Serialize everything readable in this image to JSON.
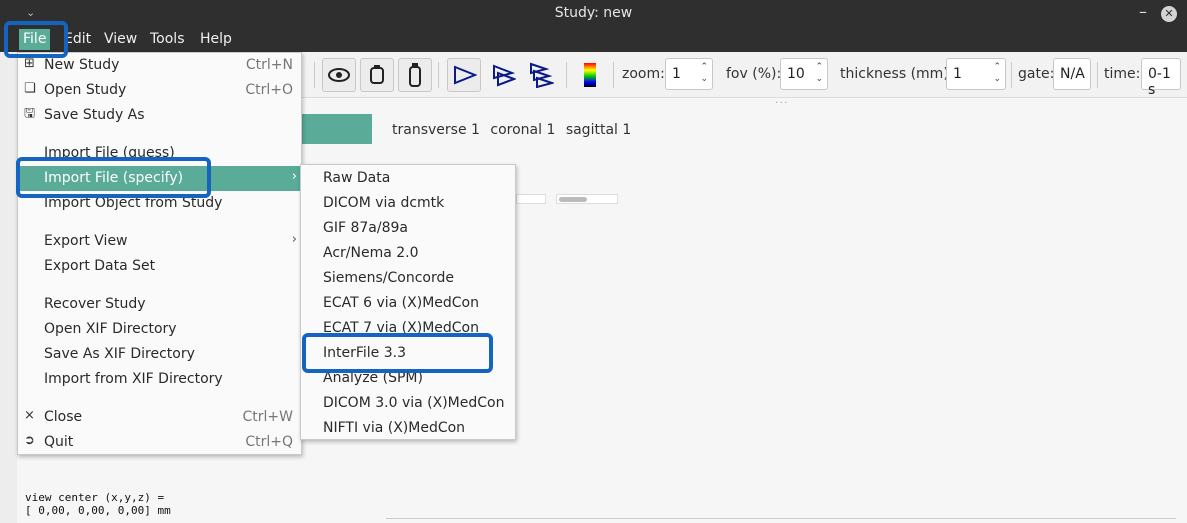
{
  "window": {
    "title": "Study: new"
  },
  "menubar": [
    {
      "label": "File",
      "active": true
    },
    {
      "label": "Edit"
    },
    {
      "label": "View"
    },
    {
      "label": "Tools"
    },
    {
      "label": "Help"
    }
  ],
  "toolbar": {
    "zoom_label": "zoom:",
    "zoom_value": "1",
    "fov_label": "fov (%):",
    "fov_value": "10",
    "thickness_label": "thickness (mm):",
    "thickness_value": "1",
    "gate_label": "gate:",
    "gate_value": "N/A",
    "time_label": "time:",
    "time_value": "0-1 s"
  },
  "view_tabs": [
    "transverse 1",
    "coronal 1",
    "sagittal 1"
  ],
  "view_center": "view center (x,y,z) =\n[ 0,00, 0,00, 0,00] mm",
  "file_menu": [
    {
      "label": "New Study",
      "accel": "Ctrl+N",
      "icon": "new-icon"
    },
    {
      "label": "Open Study",
      "accel": "Ctrl+O",
      "icon": "open-icon"
    },
    {
      "label": "Save Study As",
      "accel": "",
      "icon": "save-icon"
    },
    {
      "label": "Import File (guess)",
      "accel": ""
    },
    {
      "label": "Import File (specify)",
      "accel": "",
      "submenu": true,
      "highlighted": true
    },
    {
      "label": "Import Object from Study",
      "accel": ""
    },
    {
      "label": "Export View",
      "accel": "",
      "submenu": true
    },
    {
      "label": "Export Data Set",
      "accel": ""
    },
    {
      "label": "Recover Study",
      "accel": ""
    },
    {
      "label": "Open XIF Directory",
      "accel": ""
    },
    {
      "label": "Save As XIF Directory",
      "accel": ""
    },
    {
      "label": "Import from XIF Directory",
      "accel": ""
    },
    {
      "label": "Close",
      "accel": "Ctrl+W",
      "icon": "close-icon"
    },
    {
      "label": "Quit",
      "accel": "Ctrl+Q",
      "icon": "quit-icon"
    }
  ],
  "import_submenu": [
    "Raw Data",
    "DICOM via dcmtk",
    "GIF 87a/89a",
    "Acr/Nema 2.0",
    "Siemens/Concorde",
    "ECAT 6 via (X)MedCon",
    "ECAT 7 via (X)MedCon",
    "InterFile 3.3",
    "Analyze (SPM)",
    "DICOM 3.0 via (X)MedCon",
    "NIFTI via (X)MedCon"
  ],
  "colors": {
    "accent": "#5aab98",
    "annotation": "#1565c0",
    "titlebar": "#2f2f2f"
  }
}
